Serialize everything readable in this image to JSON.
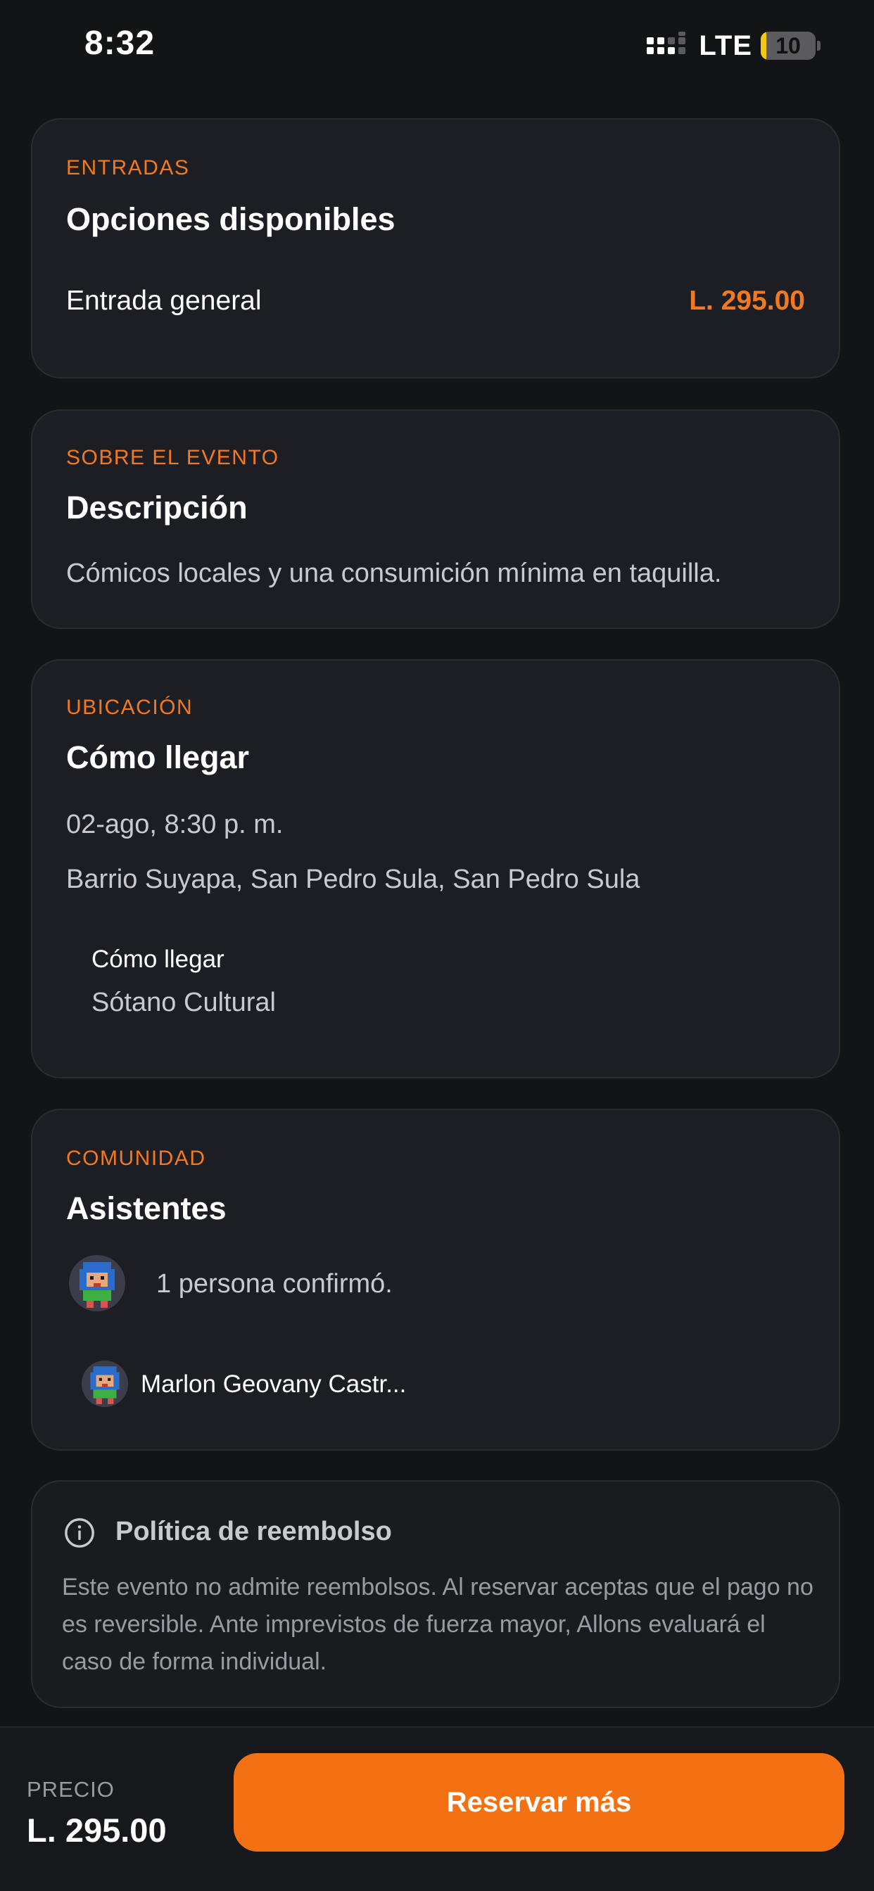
{
  "status_bar": {
    "time": "8:32",
    "network": "LTE",
    "battery_level": "10",
    "battery_fraction": 0.1,
    "signal_icon": "signal-bars-icon",
    "battery_color": "#f5c518"
  },
  "theme": {
    "accent": "#f2791e",
    "button": "#f47113",
    "card_background": "#1d1e23",
    "page_background": "#131416"
  },
  "tickets": {
    "eyebrow": "ENTRADAS",
    "title": "Opciones disponibles",
    "items": [
      {
        "name": "Entrada general",
        "price": "L. 295.00"
      }
    ]
  },
  "about": {
    "eyebrow": "SOBRE EL EVENTO",
    "title": "Descripción",
    "description": "Cómicos locales y una consumición mínima en taquilla."
  },
  "location": {
    "eyebrow": "UBICACIÓN",
    "title": "Cómo llegar",
    "datetime": "02-ago, 8:30 p. m.",
    "address": "Barrio Suyapa, San Pedro Sula, San Pedro Sula",
    "venue_label": "Cómo llegar",
    "venue_name": "Sótano Cultural"
  },
  "community": {
    "eyebrow": "COMUNIDAD",
    "title": "Asistentes",
    "confirmed_text": "1 persona confirmó.",
    "attendees": [
      {
        "name": "Marlon Geovany Castr...",
        "avatar_icon": "pixel-avatar-icon"
      }
    ]
  },
  "refund": {
    "icon": "info-icon",
    "title": "Política de reembolso",
    "text": "Este evento no admite reembolsos. Al reservar aceptas que el pago no es reversible. Ante imprevistos de fuerza mayor, Allons evaluará el caso de forma individual."
  },
  "footer": {
    "price_label": "PRECIO",
    "price_value": "L. 295.00",
    "button_label": "Reservar más"
  }
}
